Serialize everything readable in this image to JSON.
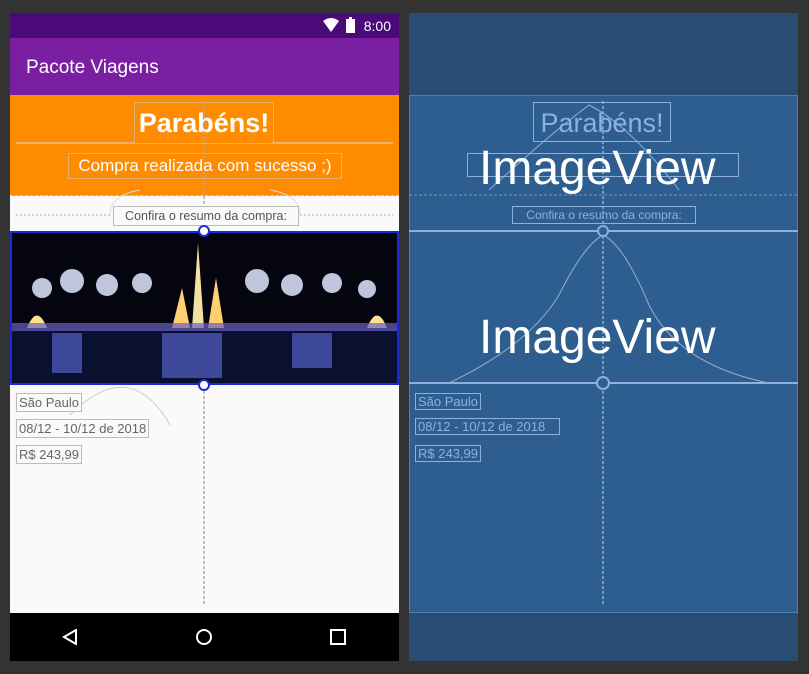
{
  "status_bar": {
    "time": "8:00"
  },
  "app_bar": {
    "title": "Pacote Viagens"
  },
  "header": {
    "title": "Parabéns!",
    "subtitle": "Compra realizada com sucesso ;)"
  },
  "summary": {
    "label": "Confira o resumo da compra:"
  },
  "details": {
    "city": "São Paulo",
    "dates": "08/12 - 10/12 de 2018",
    "price": "R$ 243,99"
  },
  "blueprint": {
    "image_label_top": "ImageView",
    "image_label_main": "ImageView"
  },
  "colors": {
    "status_bar": "#4a0a78",
    "app_bar": "#7b1fa2",
    "header": "#ff8c00",
    "blueprint_bg": "#284d73"
  },
  "icons": [
    "wifi-icon",
    "battery-icon",
    "back-icon",
    "home-icon",
    "recents-icon"
  ]
}
